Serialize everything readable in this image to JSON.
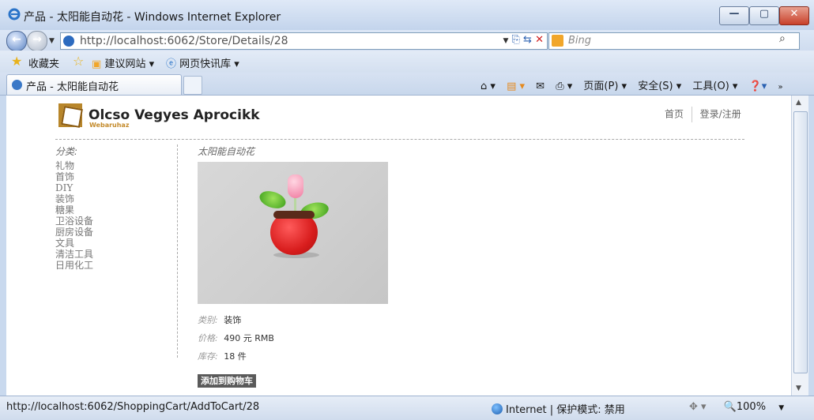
{
  "window": {
    "title": "产品 - 太阳能自动花 - Windows Internet Explorer"
  },
  "address": {
    "url": "http://localhost:6062/Store/Details/28",
    "search_placeholder": "Bing"
  },
  "favorites": {
    "label": "收藏夹",
    "items": [
      "建议网站 ▾",
      "网页快讯库 ▾"
    ]
  },
  "tab": {
    "label": "产品 - 太阳能自动花"
  },
  "commands": {
    "page": "页面(P) ▾",
    "safety": "安全(S) ▾",
    "tools": "工具(O) ▾"
  },
  "site": {
    "logo_title": "Olcso Vegyes Aprocikk",
    "logo_sub": "Webaruhaz",
    "nav": {
      "home": "首页",
      "login": "登录/注册"
    }
  },
  "sidebar": {
    "title": "分类:",
    "categories": [
      "礼物",
      "首饰",
      "DIY",
      "装饰",
      "糖果",
      "卫浴设备",
      "厨房设备",
      "文具",
      "清洁工具",
      "日用化工"
    ]
  },
  "product": {
    "title": "太阳能自动花",
    "category_label": "类别:",
    "category_value": "装饰",
    "price_label": "价格:",
    "price_value": "490 元 RMB",
    "stock_label": "库存:",
    "stock_value": "18 件",
    "add_button": "添加到购物车"
  },
  "status": {
    "url": "http://localhost:6062/ShoppingCart/AddToCart/28",
    "zone": "Internet | 保护模式: 禁用",
    "zoom": "🔍100%"
  },
  "colors": {
    "accent": "#b8862a",
    "button": "#5a5a5a"
  }
}
